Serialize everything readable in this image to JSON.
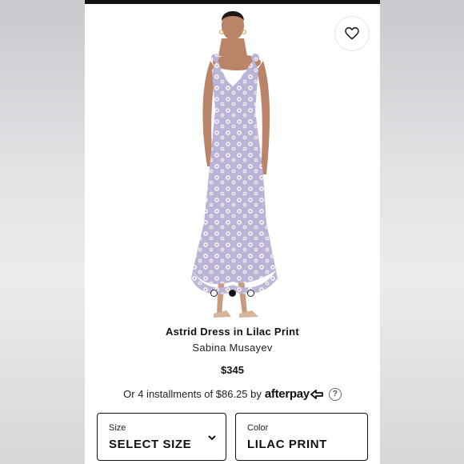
{
  "product": {
    "title": "Astrid Dress in Lilac Print",
    "brand": "Sabina Musayev",
    "price": "$345"
  },
  "payment": {
    "installments_text": "Or 4 installments of $86.25 by",
    "provider": "afterpay",
    "help": "?"
  },
  "carousel": {
    "count": 3,
    "active_index": 1
  },
  "options": {
    "size": {
      "label": "Size",
      "value": "SELECT SIZE"
    },
    "color": {
      "label": "Color",
      "value": "LILAC PRINT"
    }
  },
  "icons": {
    "favorite": "heart-icon",
    "dropdown": "chevron-down-icon",
    "afterpay": "afterpay-arrows-icon"
  },
  "colors": {
    "dress_lilac": "#b9b4d8",
    "text": "#111111"
  }
}
